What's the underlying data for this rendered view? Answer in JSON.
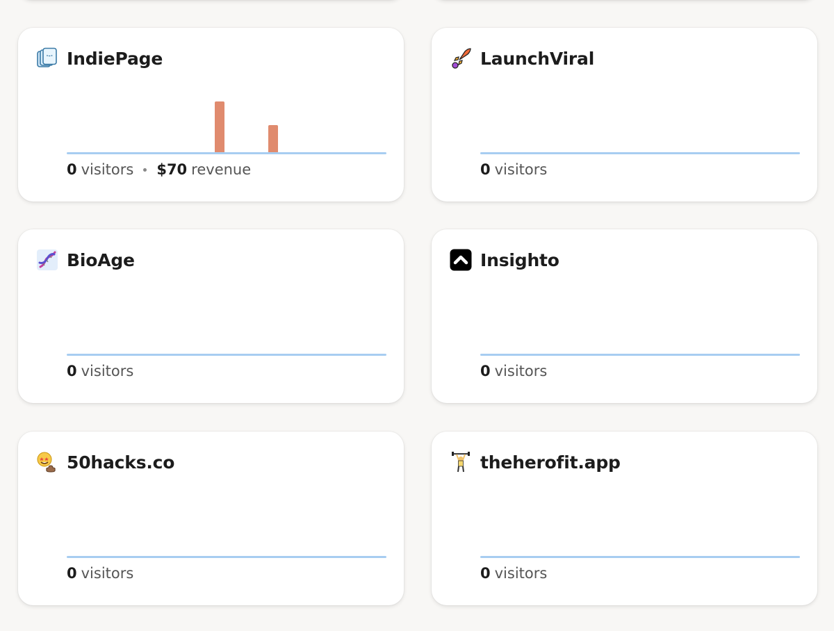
{
  "projects": [
    {
      "name": "IndiePage",
      "icon": "pages-stack-icon",
      "visitors_value": "0",
      "visitors_label": "visitors",
      "revenue_value": "$70",
      "revenue_label": "revenue",
      "bars": [
        0.93,
        0.5
      ]
    },
    {
      "name": "LaunchViral",
      "icon": "rocket-icon",
      "visitors_value": "0",
      "visitors_label": "visitors"
    },
    {
      "name": "BioAge",
      "icon": "dna-icon",
      "visitors_value": "0",
      "visitors_label": "visitors"
    },
    {
      "name": "Insighto",
      "icon": "chevron-up-square-icon",
      "visitors_value": "0",
      "visitors_label": "visitors"
    },
    {
      "name": "50hacks.co",
      "icon": "star-struck-poop-icon",
      "visitors_value": "0",
      "visitors_label": "visitors"
    },
    {
      "name": "theherofit.app",
      "icon": "weightlifter-icon",
      "visitors_value": "0",
      "visitors_label": "visitors"
    }
  ],
  "colors": {
    "bar": "#e08b6e",
    "baseline": "#a7cdf1"
  }
}
